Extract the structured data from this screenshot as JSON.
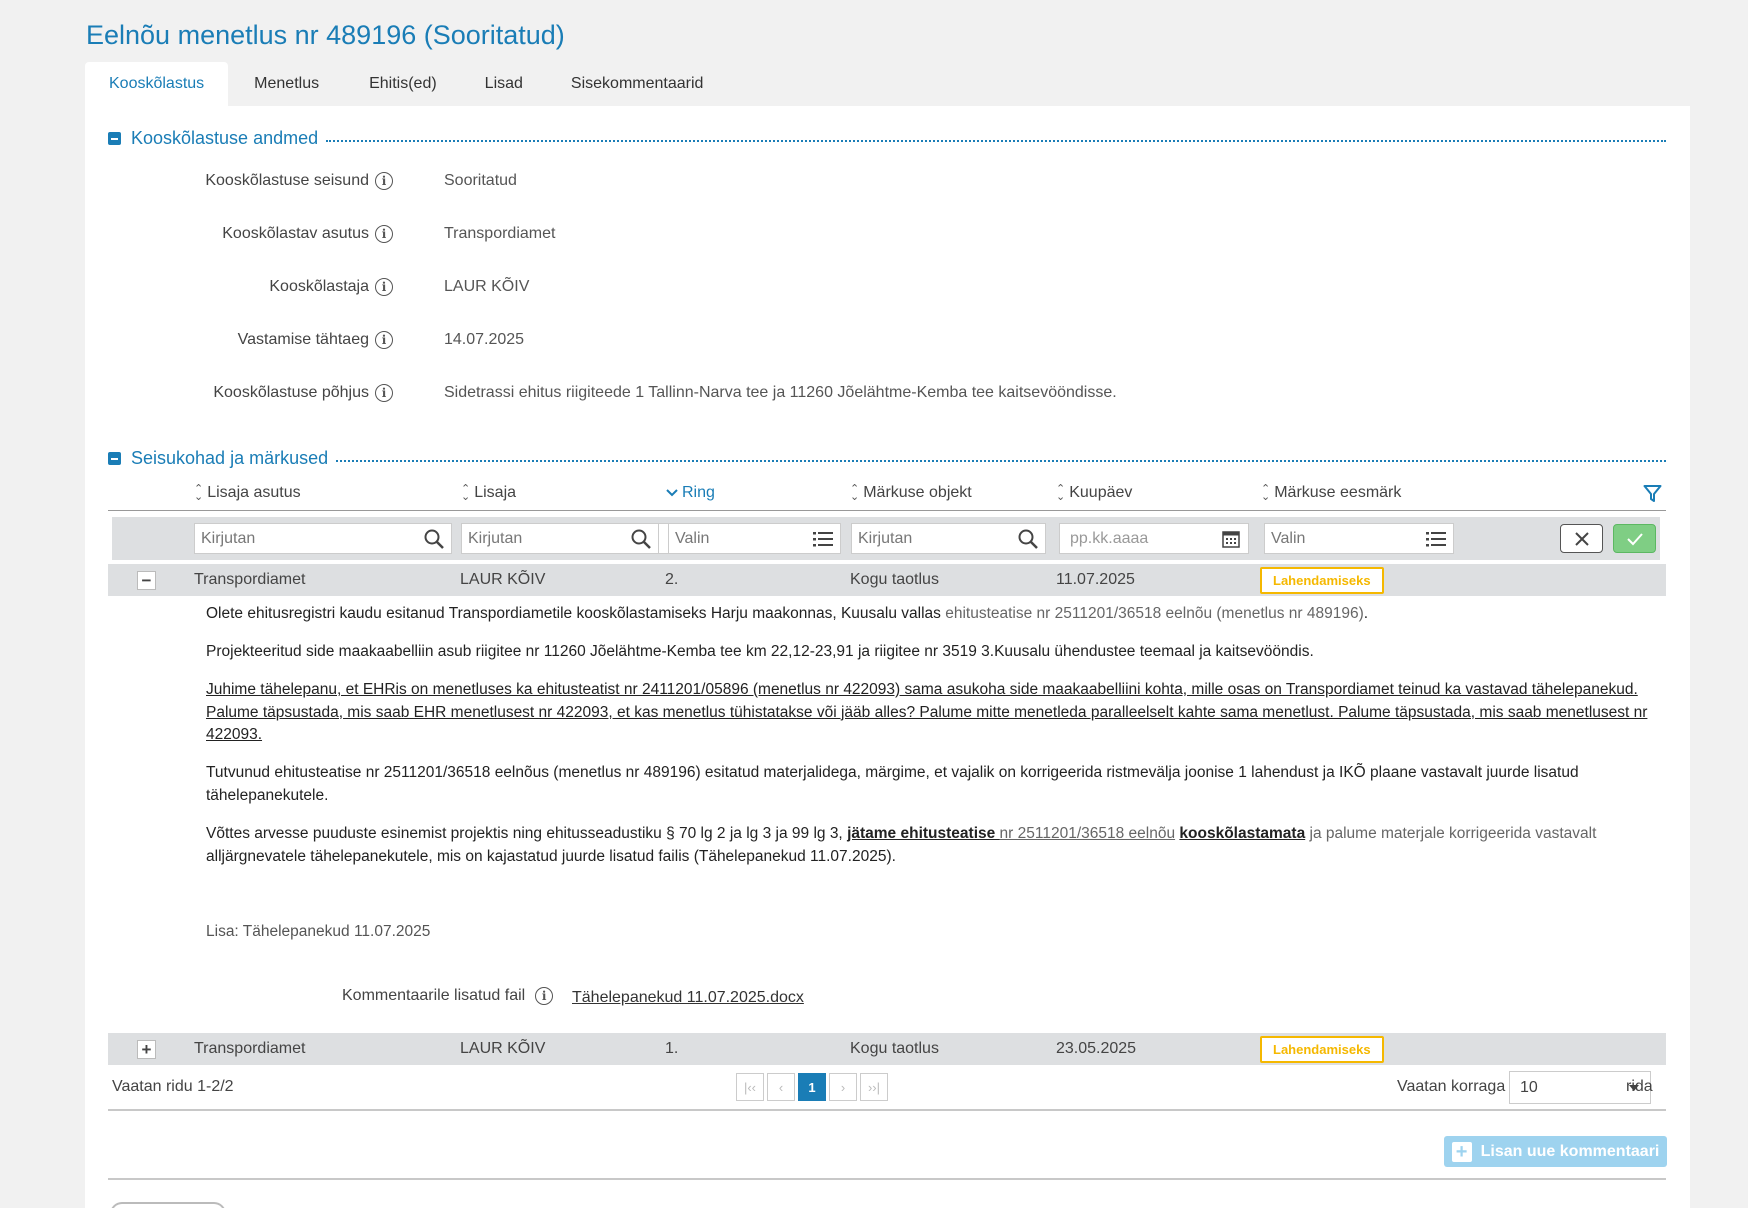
{
  "page_title": "Eelnõu menetlus nr 489196 (Sooritatud)",
  "tabs": [
    "Kooskõlastus",
    "Menetlus",
    "Ehitis(ed)",
    "Lisad",
    "Sisekommentaarid"
  ],
  "section1": {
    "title": "Kooskõlastuse andmed",
    "fields": [
      {
        "label": "Kooskõlastuse seisund",
        "value": "Sooritatud"
      },
      {
        "label": "Kooskõlastav asutus",
        "value": "Transpordiamet"
      },
      {
        "label": "Kooskõlastaja",
        "value": "LAUR KÕIV"
      },
      {
        "label": "Vastamise tähtaeg",
        "value": "14.07.2025"
      },
      {
        "label": "Kooskõlastuse põhjus",
        "value": "Sidetrassi ehitus riigiteede 1 Tallinn-Narva tee ja 11260 Jõelähtme-Kemba tee kaitsevööndisse."
      }
    ]
  },
  "section2": {
    "title": "Seisukohad ja märkused",
    "columns": [
      "Lisaja asutus",
      "Lisaja",
      "Ring",
      "Märkuse objekt",
      "Kuupäev",
      "Märkuse eesmärk"
    ],
    "filters": {
      "lisaja_asutus": "Kirjutan",
      "lisaja": "Kirjutan",
      "ring": "Valin",
      "objekt": "Kirjutan",
      "kuupaev": "pp.kk.aaaa",
      "eesmark": "Valin"
    },
    "rows": [
      {
        "asutus": "Transpordiamet",
        "lisaja": "LAUR KÕIV",
        "ring": "2.",
        "objekt": "Kogu taotlus",
        "kuupaev": "11.07.2025",
        "eesmark": "Lahendamiseks",
        "toggle": "−"
      },
      {
        "asutus": "Transpordiamet",
        "lisaja": "LAUR KÕIV",
        "ring": "1.",
        "objekt": "Kogu taotlus",
        "kuupaev": "23.05.2025",
        "eesmark": "Lahendamiseks",
        "toggle": "+"
      }
    ],
    "detail": {
      "p1a": "Olete ehitusregistri kaudu esitanud Transpordiametile kooskõlastamiseks Harju maakonnas, Kuusalu vallas ",
      "p1b": "ehitusteatise nr 2511201/36518 eelnõu (menetlus nr 489196)",
      "p1c": ".",
      "p2": "Projekteeritud side maakaabelliin asub riigitee nr 11260 Jõelähtme-Kemba tee km 22,12-23,91 ja riigitee nr 3519 3.Kuusalu ühendustee teemaal ja kaitsevööndis.",
      "p3": "Juhime tähelepanu, et EHRis on menetluses ka ehitusteatist nr 2411201/05896 (menetlus nr 422093) sama asukoha side maakaabelliini kohta, mille osas on Transpordiamet teinud ka vastavad tähelepanekud. Palume täpsustada, mis saab EHR menetlusest nr 422093, et kas menetlus tühistatakse või jääb alles? Palume mitte menetleda paralleelselt kahte sama menetlust. Palume täpsustada, mis saab menetlusest nr 422093.",
      "p4": "Tutvunud ehitusteatise nr 2511201/36518 eelnõus (menetlus nr 489196) esitatud materjalidega, märgime, et vajalik on korrigeerida ristmevälja joonise 1 lahendust ja IKÕ plaane vastavalt juurde lisatud tähelepanekutele.",
      "p5a": "Võttes arvesse puuduste esinemist projektis ning ehitusseadustiku § 70 lg 2 ja lg 3 ja 99 lg 3, ",
      "p5b": "jätame ehitusteatise ",
      "p5c": "nr 2511201/36518 eelnõu",
      "p5d": " ",
      "p5e": "kooskõlastamata",
      "p5f": " ja palume materjale korrigeerida vastavalt",
      "p5g": " alljärgnevatele tähelepanekutele, mis on kajastatud juurde lisatud failis (Tähelepanekud 11.07.2025).",
      "lisa": "Lisa: Tähelepanekud 11.07.2025",
      "file_label": "Kommentaarile lisatud fail",
      "file_name": "Tähelepanekud 11.07.2025.docx"
    },
    "footer": {
      "showing": "Vaatan ridu 1-2/2",
      "page": "1",
      "per_page_label": "Vaatan korraga",
      "per_page": "10",
      "rows_label": "rida"
    },
    "add_comment": "Lisan uue kommentaari"
  },
  "colors": {
    "accent": "#1a7db6",
    "badge": "#f5b800",
    "success": "#6cc56c"
  }
}
